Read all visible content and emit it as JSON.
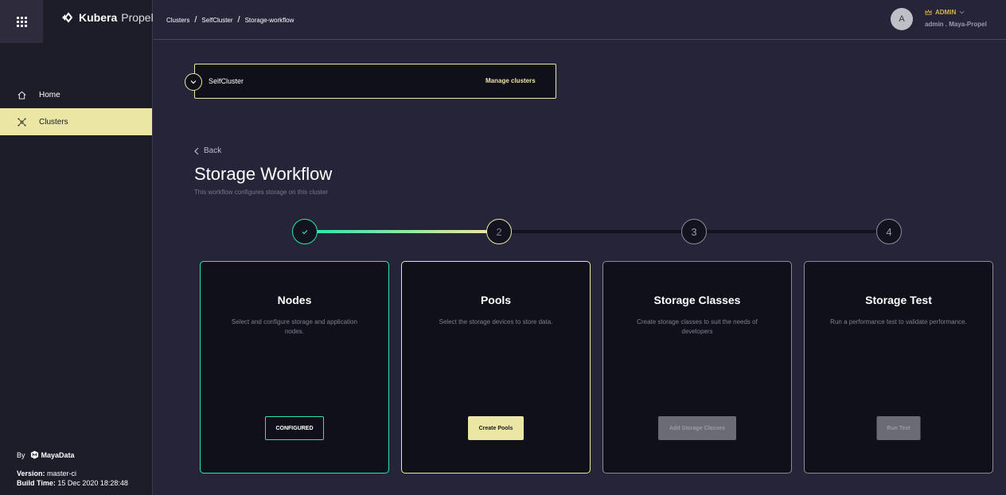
{
  "app": {
    "logo_bold": "Kubera",
    "logo_light": "Propel"
  },
  "sidebar": {
    "items": [
      {
        "label": "Home",
        "icon": "home-icon",
        "active": false
      },
      {
        "label": "Clusters",
        "icon": "cluster-icon",
        "active": true
      }
    ],
    "footer": {
      "by": "By",
      "company": "MayaData",
      "version_label": "Version:",
      "version": "master-ci",
      "build_label": "Build Time:",
      "build_time": "15 Dec 2020 18:28:48"
    }
  },
  "header": {
    "breadcrumb": [
      "Clusters",
      "SelfCluster",
      "Storage-workflow"
    ],
    "breadcrumb_sep": "/",
    "avatar_initial": "A",
    "role": "ADMIN",
    "user": "admin . Maya-Propel"
  },
  "cluster": {
    "name": "SelfCluster",
    "manage_label": "Manage clusters"
  },
  "page": {
    "back_label": "Back",
    "title": "Storage Workflow",
    "subtitle": "This workflow configures storage on this cluster"
  },
  "stepper": {
    "steps": [
      {
        "label": "✓",
        "state": "done"
      },
      {
        "label": "2",
        "state": "current"
      },
      {
        "label": "3",
        "state": "pending"
      },
      {
        "label": "4",
        "state": "pending"
      }
    ],
    "colors": {
      "done": "#2ee6a8",
      "current": "#ebe6a3",
      "pending": "#131320"
    }
  },
  "cards": [
    {
      "title": "Nodes",
      "desc": "Select and configure storage and application nodes.",
      "button": "CONFIGURED"
    },
    {
      "title": "Pools",
      "desc": "Select the storage devices to store data.",
      "button": "Create Pools"
    },
    {
      "title": "Storage Classes",
      "desc": "Create storage classes to suit the needs of developers",
      "button": "Add Storage Classes"
    },
    {
      "title": "Storage Test",
      "desc": "Run a performance test to validate performance.",
      "button": "Run Test"
    }
  ]
}
